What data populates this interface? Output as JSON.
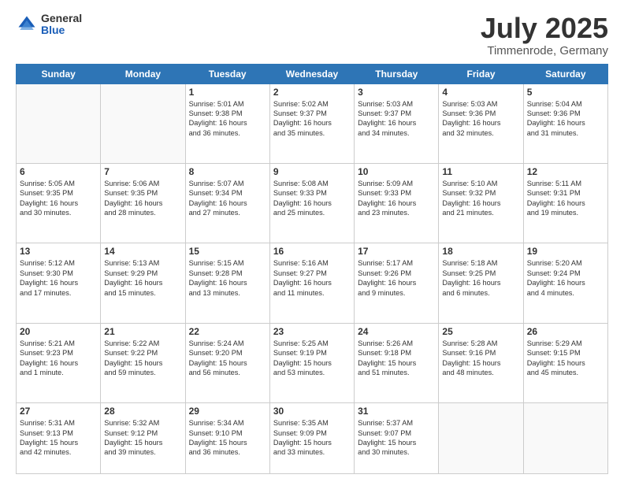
{
  "logo": {
    "general": "General",
    "blue": "Blue"
  },
  "header": {
    "title": "July 2025",
    "subtitle": "Timmenrode, Germany"
  },
  "days_of_week": [
    "Sunday",
    "Monday",
    "Tuesday",
    "Wednesday",
    "Thursday",
    "Friday",
    "Saturday"
  ],
  "weeks": [
    [
      {
        "day": "",
        "info": ""
      },
      {
        "day": "",
        "info": ""
      },
      {
        "day": "1",
        "info": "Sunrise: 5:01 AM\nSunset: 9:38 PM\nDaylight: 16 hours\nand 36 minutes."
      },
      {
        "day": "2",
        "info": "Sunrise: 5:02 AM\nSunset: 9:37 PM\nDaylight: 16 hours\nand 35 minutes."
      },
      {
        "day": "3",
        "info": "Sunrise: 5:03 AM\nSunset: 9:37 PM\nDaylight: 16 hours\nand 34 minutes."
      },
      {
        "day": "4",
        "info": "Sunrise: 5:03 AM\nSunset: 9:36 PM\nDaylight: 16 hours\nand 32 minutes."
      },
      {
        "day": "5",
        "info": "Sunrise: 5:04 AM\nSunset: 9:36 PM\nDaylight: 16 hours\nand 31 minutes."
      }
    ],
    [
      {
        "day": "6",
        "info": "Sunrise: 5:05 AM\nSunset: 9:35 PM\nDaylight: 16 hours\nand 30 minutes."
      },
      {
        "day": "7",
        "info": "Sunrise: 5:06 AM\nSunset: 9:35 PM\nDaylight: 16 hours\nand 28 minutes."
      },
      {
        "day": "8",
        "info": "Sunrise: 5:07 AM\nSunset: 9:34 PM\nDaylight: 16 hours\nand 27 minutes."
      },
      {
        "day": "9",
        "info": "Sunrise: 5:08 AM\nSunset: 9:33 PM\nDaylight: 16 hours\nand 25 minutes."
      },
      {
        "day": "10",
        "info": "Sunrise: 5:09 AM\nSunset: 9:33 PM\nDaylight: 16 hours\nand 23 minutes."
      },
      {
        "day": "11",
        "info": "Sunrise: 5:10 AM\nSunset: 9:32 PM\nDaylight: 16 hours\nand 21 minutes."
      },
      {
        "day": "12",
        "info": "Sunrise: 5:11 AM\nSunset: 9:31 PM\nDaylight: 16 hours\nand 19 minutes."
      }
    ],
    [
      {
        "day": "13",
        "info": "Sunrise: 5:12 AM\nSunset: 9:30 PM\nDaylight: 16 hours\nand 17 minutes."
      },
      {
        "day": "14",
        "info": "Sunrise: 5:13 AM\nSunset: 9:29 PM\nDaylight: 16 hours\nand 15 minutes."
      },
      {
        "day": "15",
        "info": "Sunrise: 5:15 AM\nSunset: 9:28 PM\nDaylight: 16 hours\nand 13 minutes."
      },
      {
        "day": "16",
        "info": "Sunrise: 5:16 AM\nSunset: 9:27 PM\nDaylight: 16 hours\nand 11 minutes."
      },
      {
        "day": "17",
        "info": "Sunrise: 5:17 AM\nSunset: 9:26 PM\nDaylight: 16 hours\nand 9 minutes."
      },
      {
        "day": "18",
        "info": "Sunrise: 5:18 AM\nSunset: 9:25 PM\nDaylight: 16 hours\nand 6 minutes."
      },
      {
        "day": "19",
        "info": "Sunrise: 5:20 AM\nSunset: 9:24 PM\nDaylight: 16 hours\nand 4 minutes."
      }
    ],
    [
      {
        "day": "20",
        "info": "Sunrise: 5:21 AM\nSunset: 9:23 PM\nDaylight: 16 hours\nand 1 minute."
      },
      {
        "day": "21",
        "info": "Sunrise: 5:22 AM\nSunset: 9:22 PM\nDaylight: 15 hours\nand 59 minutes."
      },
      {
        "day": "22",
        "info": "Sunrise: 5:24 AM\nSunset: 9:20 PM\nDaylight: 15 hours\nand 56 minutes."
      },
      {
        "day": "23",
        "info": "Sunrise: 5:25 AM\nSunset: 9:19 PM\nDaylight: 15 hours\nand 53 minutes."
      },
      {
        "day": "24",
        "info": "Sunrise: 5:26 AM\nSunset: 9:18 PM\nDaylight: 15 hours\nand 51 minutes."
      },
      {
        "day": "25",
        "info": "Sunrise: 5:28 AM\nSunset: 9:16 PM\nDaylight: 15 hours\nand 48 minutes."
      },
      {
        "day": "26",
        "info": "Sunrise: 5:29 AM\nSunset: 9:15 PM\nDaylight: 15 hours\nand 45 minutes."
      }
    ],
    [
      {
        "day": "27",
        "info": "Sunrise: 5:31 AM\nSunset: 9:13 PM\nDaylight: 15 hours\nand 42 minutes."
      },
      {
        "day": "28",
        "info": "Sunrise: 5:32 AM\nSunset: 9:12 PM\nDaylight: 15 hours\nand 39 minutes."
      },
      {
        "day": "29",
        "info": "Sunrise: 5:34 AM\nSunset: 9:10 PM\nDaylight: 15 hours\nand 36 minutes."
      },
      {
        "day": "30",
        "info": "Sunrise: 5:35 AM\nSunset: 9:09 PM\nDaylight: 15 hours\nand 33 minutes."
      },
      {
        "day": "31",
        "info": "Sunrise: 5:37 AM\nSunset: 9:07 PM\nDaylight: 15 hours\nand 30 minutes."
      },
      {
        "day": "",
        "info": ""
      },
      {
        "day": "",
        "info": ""
      }
    ]
  ]
}
